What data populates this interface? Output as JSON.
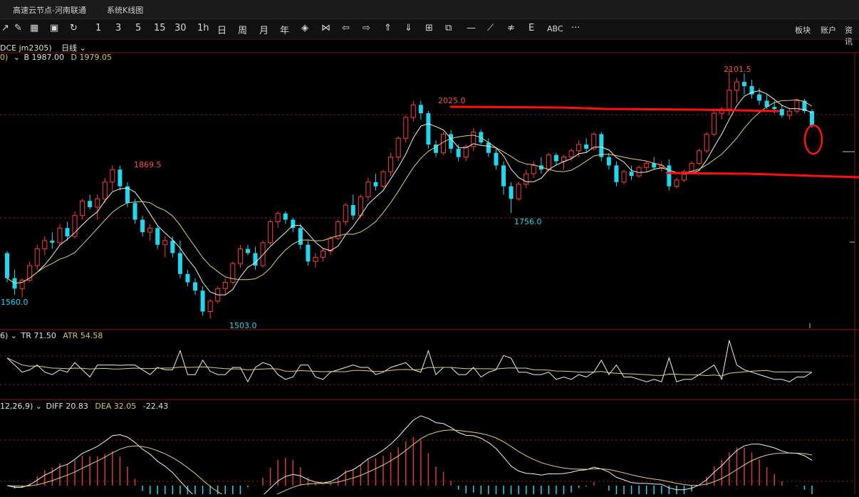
{
  "titlebar": {
    "tabs": [
      "高速云节点-河南联通",
      "系统K线图"
    ]
  },
  "toolbar": {
    "items": [
      "1",
      "3",
      "5",
      "15",
      "30",
      "1h",
      "日",
      "周",
      "月",
      "年"
    ],
    "text_tool": "ABC",
    "more": "···",
    "right": [
      "板块",
      "账户",
      "资讯"
    ]
  },
  "main_panel": {
    "info_prefix": "0)",
    "symbol": "DCE jm2305)",
    "period": "日线",
    "b_label": "B 1987.00",
    "d_label": "D 1979.05",
    "annotations": {
      "high_1": "2101.5",
      "high_2": "2025.0",
      "high_3": "1869.5",
      "low_1": "1756.0",
      "low_2": "1560.0",
      "low_3": "1503.0"
    }
  },
  "atr_panel": {
    "prefix": "6)",
    "tr": "TR 71.50",
    "atr": "ATR 54.58"
  },
  "macd_panel": {
    "prefix": "12,26,9)",
    "diff": "DIFF 20.83",
    "dea": "DEA 32.05",
    "macd": "-22.43"
  },
  "chart_data": {
    "type": "candlestick",
    "symbol": "DCE jm2305",
    "period": "日线",
    "ohlc": [
      [
        1660,
        1665,
        1590,
        1600
      ],
      [
        1600,
        1620,
        1560,
        1575
      ],
      [
        1575,
        1600,
        1555,
        1595
      ],
      [
        1595,
        1640,
        1590,
        1630
      ],
      [
        1630,
        1680,
        1620,
        1670
      ],
      [
        1670,
        1700,
        1655,
        1690
      ],
      [
        1690,
        1710,
        1670,
        1685
      ],
      [
        1685,
        1730,
        1680,
        1720
      ],
      [
        1720,
        1735,
        1690,
        1700
      ],
      [
        1700,
        1760,
        1695,
        1750
      ],
      [
        1750,
        1790,
        1740,
        1785
      ],
      [
        1785,
        1800,
        1765,
        1770
      ],
      [
        1770,
        1800,
        1740,
        1790
      ],
      [
        1790,
        1840,
        1780,
        1830
      ],
      [
        1830,
        1870,
        1810,
        1860
      ],
      [
        1860,
        1869.5,
        1810,
        1820
      ],
      [
        1820,
        1830,
        1770,
        1780
      ],
      [
        1780,
        1790,
        1730,
        1740
      ],
      [
        1740,
        1750,
        1700,
        1710
      ],
      [
        1710,
        1730,
        1690,
        1720
      ],
      [
        1720,
        1725,
        1670,
        1680
      ],
      [
        1680,
        1700,
        1650,
        1690
      ],
      [
        1690,
        1700,
        1650,
        1660
      ],
      [
        1660,
        1690,
        1600,
        1610
      ],
      [
        1610,
        1620,
        1580,
        1590
      ],
      [
        1590,
        1600,
        1560,
        1570
      ],
      [
        1570,
        1580,
        1510,
        1520
      ],
      [
        1520,
        1550,
        1503,
        1545
      ],
      [
        1545,
        1580,
        1540,
        1575
      ],
      [
        1575,
        1600,
        1560,
        1590
      ],
      [
        1590,
        1640,
        1585,
        1635
      ],
      [
        1635,
        1680,
        1625,
        1670
      ],
      [
        1670,
        1680,
        1655,
        1660
      ],
      [
        1660,
        1675,
        1620,
        1630
      ],
      [
        1630,
        1690,
        1625,
        1685
      ],
      [
        1685,
        1740,
        1680,
        1735
      ],
      [
        1735,
        1760,
        1720,
        1755
      ],
      [
        1755,
        1760,
        1730,
        1740
      ],
      [
        1740,
        1745,
        1710,
        1720
      ],
      [
        1720,
        1730,
        1670,
        1680
      ],
      [
        1680,
        1690,
        1630,
        1640
      ],
      [
        1640,
        1660,
        1625,
        1650
      ],
      [
        1650,
        1670,
        1640,
        1665
      ],
      [
        1665,
        1700,
        1655,
        1695
      ],
      [
        1695,
        1740,
        1690,
        1735
      ],
      [
        1735,
        1780,
        1725,
        1775
      ],
      [
        1775,
        1800,
        1740,
        1750
      ],
      [
        1750,
        1800,
        1745,
        1795
      ],
      [
        1795,
        1840,
        1785,
        1830
      ],
      [
        1830,
        1850,
        1810,
        1820
      ],
      [
        1820,
        1860,
        1815,
        1855
      ],
      [
        1855,
        1900,
        1845,
        1890
      ],
      [
        1890,
        1940,
        1880,
        1935
      ],
      [
        1935,
        1990,
        1925,
        1985
      ],
      [
        1985,
        2025,
        1975,
        2015
      ],
      [
        2015,
        2025,
        1980,
        1995
      ],
      [
        1995,
        2000,
        1910,
        1920
      ],
      [
        1920,
        1930,
        1890,
        1900
      ],
      [
        1900,
        1950,
        1895,
        1945
      ],
      [
        1945,
        1955,
        1900,
        1910
      ],
      [
        1910,
        1920,
        1880,
        1890
      ],
      [
        1890,
        1920,
        1880,
        1915
      ],
      [
        1915,
        1960,
        1905,
        1950
      ],
      [
        1950,
        1955,
        1920,
        1925
      ],
      [
        1925,
        1935,
        1890,
        1900
      ],
      [
        1900,
        1910,
        1860,
        1870
      ],
      [
        1870,
        1880,
        1800,
        1820
      ],
      [
        1820,
        1830,
        1756,
        1790
      ],
      [
        1790,
        1830,
        1785,
        1825
      ],
      [
        1825,
        1860,
        1815,
        1850
      ],
      [
        1850,
        1880,
        1840,
        1870
      ],
      [
        1870,
        1890,
        1850,
        1860
      ],
      [
        1860,
        1900,
        1855,
        1895
      ],
      [
        1895,
        1900,
        1870,
        1880
      ],
      [
        1880,
        1895,
        1860,
        1890
      ],
      [
        1890,
        1910,
        1880,
        1905
      ],
      [
        1905,
        1930,
        1890,
        1920
      ],
      [
        1920,
        1935,
        1900,
        1910
      ],
      [
        1910,
        1950,
        1905,
        1945
      ],
      [
        1945,
        1950,
        1880,
        1890
      ],
      [
        1890,
        1900,
        1860,
        1870
      ],
      [
        1870,
        1880,
        1820,
        1830
      ],
      [
        1830,
        1860,
        1825,
        1855
      ],
      [
        1855,
        1870,
        1835,
        1845
      ],
      [
        1845,
        1870,
        1840,
        1865
      ],
      [
        1865,
        1880,
        1855,
        1875
      ],
      [
        1875,
        1890,
        1860,
        1865
      ],
      [
        1865,
        1880,
        1855,
        1870
      ],
      [
        1870,
        1885,
        1810,
        1820
      ],
      [
        1820,
        1840,
        1815,
        1835
      ],
      [
        1835,
        1860,
        1830,
        1855
      ],
      [
        1855,
        1880,
        1850,
        1875
      ],
      [
        1875,
        1910,
        1870,
        1905
      ],
      [
        1905,
        1950,
        1900,
        1945
      ],
      [
        1945,
        2000,
        1940,
        1995
      ],
      [
        1995,
        2010,
        1980,
        2005
      ],
      [
        2005,
        2101.5,
        1990,
        2050
      ],
      [
        2050,
        2080,
        2020,
        2070
      ],
      [
        2070,
        2090,
        2040,
        2060
      ],
      [
        2060,
        2075,
        2030,
        2040
      ],
      [
        2040,
        2055,
        2015,
        2025
      ],
      [
        2025,
        2040,
        2005,
        2010
      ],
      [
        2010,
        2025,
        1995,
        2005
      ],
      [
        2005,
        2015,
        1985,
        1990
      ],
      [
        1990,
        2005,
        1980,
        2000
      ],
      [
        2000,
        2030,
        1995,
        2025
      ],
      [
        2025,
        2030,
        1995,
        2000
      ],
      [
        2000,
        2005,
        1960,
        1965
      ]
    ],
    "ylim": [
      1480,
      2140
    ],
    "marked_high": 2101.5,
    "marked_low": 1503.0
  }
}
